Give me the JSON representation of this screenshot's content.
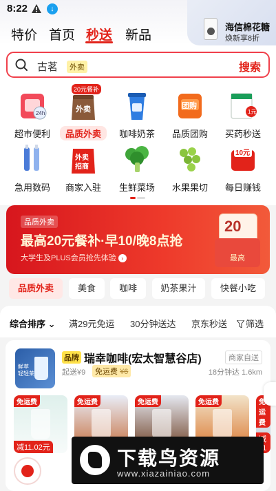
{
  "status_bar": {
    "time": "8:22"
  },
  "corner_ad": {
    "title": "海信棉花糖",
    "subtitle": "焕新享8折"
  },
  "top_tabs": [
    {
      "label": "特价"
    },
    {
      "label": "首页"
    },
    {
      "label": "秒送",
      "active": true
    },
    {
      "label": "新品"
    }
  ],
  "search": {
    "query": "古茗",
    "tag": "外卖",
    "button": "搜索"
  },
  "categories": [
    {
      "label": "超市便利",
      "icon": "supermarket-icon",
      "color": "#f24a5a"
    },
    {
      "label": "品质外卖",
      "icon": "takeout-bag-icon",
      "color": "#8a5a3a",
      "badge": "20元餐补",
      "active": true
    },
    {
      "label": "咖啡奶茶",
      "icon": "coffee-cup-icon",
      "color": "#2f7de1"
    },
    {
      "label": "品质团购",
      "icon": "group-buy-ticket-icon",
      "color": "#f26b1d"
    },
    {
      "label": "买药秒送",
      "icon": "medicine-box-icon",
      "color": "#1a9e5a"
    },
    {
      "label": "急用数码",
      "icon": "cable-icon",
      "color": "#4a7bd8"
    },
    {
      "label": "商家入驻",
      "icon": "merchant-join-icon",
      "color": "#e2231a"
    },
    {
      "label": "生鲜菜场",
      "icon": "broccoli-icon",
      "color": "#3fa53a"
    },
    {
      "label": "水果果切",
      "icon": "grapes-icon",
      "color": "#8bc53f"
    },
    {
      "label": "每日赚钱",
      "icon": "money-icon",
      "color": "#e2231a"
    }
  ],
  "category_icon_text": {
    "takeout": "外卖",
    "merchant": "外卖\n招商",
    "group": "团购",
    "money": "10元"
  },
  "promo": {
    "tag": "品质外卖",
    "title": "最高20元餐补·早10/晚8点抢",
    "subtitle": "大学生及PLUS会员抢先体验",
    "coupon_amount": "20",
    "coupon_label": "最高"
  },
  "chips": [
    {
      "label": "品质外卖",
      "active": true
    },
    {
      "label": "美食"
    },
    {
      "label": "咖啡"
    },
    {
      "label": "奶茶果汁"
    },
    {
      "label": "快餐小吃"
    }
  ],
  "sort": {
    "default": "综合排序",
    "items": [
      "满29元免运",
      "30分钟送达",
      "京东秒送"
    ],
    "filter": "筛选"
  },
  "store": {
    "brand_tag": "品牌",
    "name": "瑞幸咖啡(宏太智慧谷店)",
    "delivery_type": "商家自送",
    "min_order": "起送¥9",
    "free_delivery": "免运费",
    "free_delivery_strike": "¥6",
    "time_distance": "18分钟达  1.6km",
    "logo_text": "鲜萃\n轻轻茉莉",
    "products": [
      {
        "badge": "免运费",
        "price": "减11.02元"
      },
      {
        "badge": "免运费"
      },
      {
        "badge": "免运费"
      },
      {
        "badge": "免运费"
      },
      {
        "badge": "免运费",
        "price": "减11"
      }
    ]
  },
  "watermark": {
    "title": "下载鸟资源",
    "url": "www.xiazainiao.com"
  },
  "colors": {
    "brand_red": "#e2231a",
    "search_border": "#f0404b"
  }
}
